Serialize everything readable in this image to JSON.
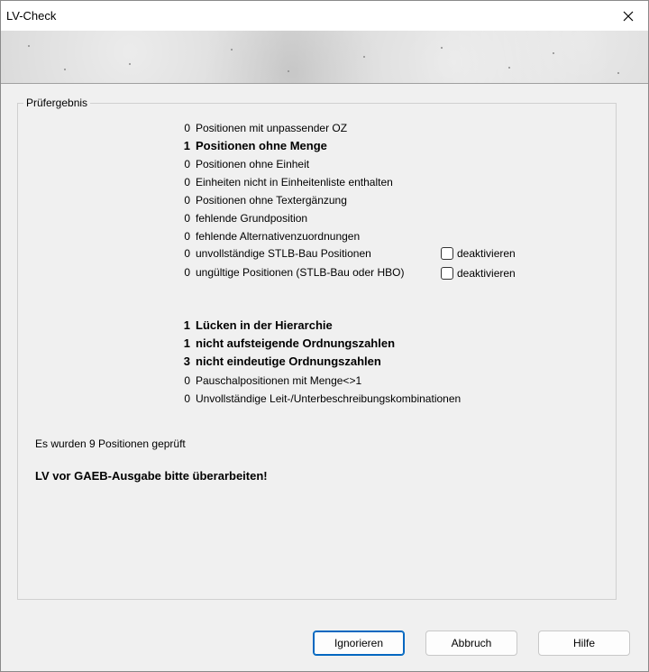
{
  "window": {
    "title": "LV-Check"
  },
  "group": {
    "label": "Prüfergebnis"
  },
  "results_top": [
    {
      "count": "0",
      "label": "Positionen mit unpassender OZ",
      "bold": false
    },
    {
      "count": "1",
      "label": "Positionen ohne Menge",
      "bold": true
    },
    {
      "count": "0",
      "label": "Positionen ohne Einheit",
      "bold": false
    },
    {
      "count": "0",
      "label": "Einheiten nicht in Einheitenliste enthalten",
      "bold": false
    },
    {
      "count": "0",
      "label": "Positionen ohne Textergänzung",
      "bold": false
    },
    {
      "count": "0",
      "label": "fehlende Grundposition",
      "bold": false
    },
    {
      "count": "0",
      "label": "fehlende Alternativenzuordnungen",
      "bold": false
    },
    {
      "count": "0",
      "label": "unvollständige STLB-Bau Positionen",
      "bold": false,
      "checkbox": "deaktivieren"
    },
    {
      "count": "0",
      "label": "ungültige Positionen (STLB-Bau oder HBO)",
      "bold": false,
      "checkbox": "deaktivieren"
    }
  ],
  "results_bottom": [
    {
      "count": "1",
      "label": "Lücken in der Hierarchie",
      "bold": true
    },
    {
      "count": "1",
      "label": "nicht aufsteigende Ordnungszahlen",
      "bold": true
    },
    {
      "count": "3",
      "label": "nicht eindeutige Ordnungszahlen",
      "bold": true
    },
    {
      "count": "0",
      "label": "Pauschalpositionen mit Menge<>1",
      "bold": false
    },
    {
      "count": "0",
      "label": "Unvollständige Leit-/Unterbeschreibungskombinationen",
      "bold": false
    }
  ],
  "summary": {
    "info": "Es wurden 9 Positionen geprüft",
    "warning": "LV vor GAEB-Ausgabe bitte überarbeiten!"
  },
  "buttons": {
    "ignore": "Ignorieren",
    "cancel": "Abbruch",
    "help": "Hilfe"
  },
  "colors": {
    "accent": "#0067c0",
    "background": "#f0f0f0"
  }
}
